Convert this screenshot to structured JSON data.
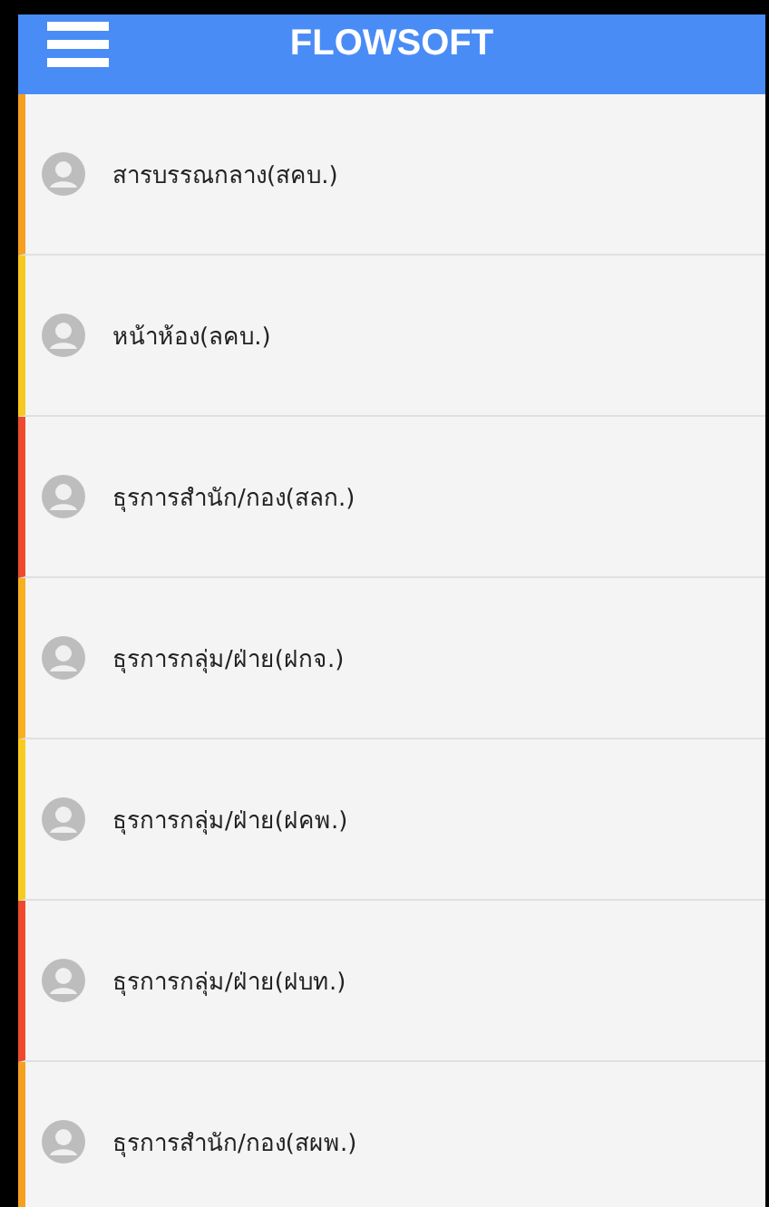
{
  "header": {
    "title": "FLOWSOFT"
  },
  "items": [
    {
      "label": "สารบรรณกลาง(สคบ.)",
      "color": "#f5a01e"
    },
    {
      "label": "หน้าห้อง(ลคบ.)",
      "color": "#f7c81e"
    },
    {
      "label": "ธุรการสำนัก/กอง(สลก.)",
      "color": "#ee4a2b"
    },
    {
      "label": "ธุรการกลุ่ม/ฝ่าย(ฝกจ.)",
      "color": "#f7b01e"
    },
    {
      "label": "ธุรการกลุ่ม/ฝ่าย(ฝคพ.)",
      "color": "#f7cc1e"
    },
    {
      "label": "ธุรการกลุ่ม/ฝ่าย(ฝบท.)",
      "color": "#ee4a2b"
    },
    {
      "label": "ธุรการสำนัก/กอง(สผพ.)",
      "color": "#f5a01e"
    }
  ]
}
